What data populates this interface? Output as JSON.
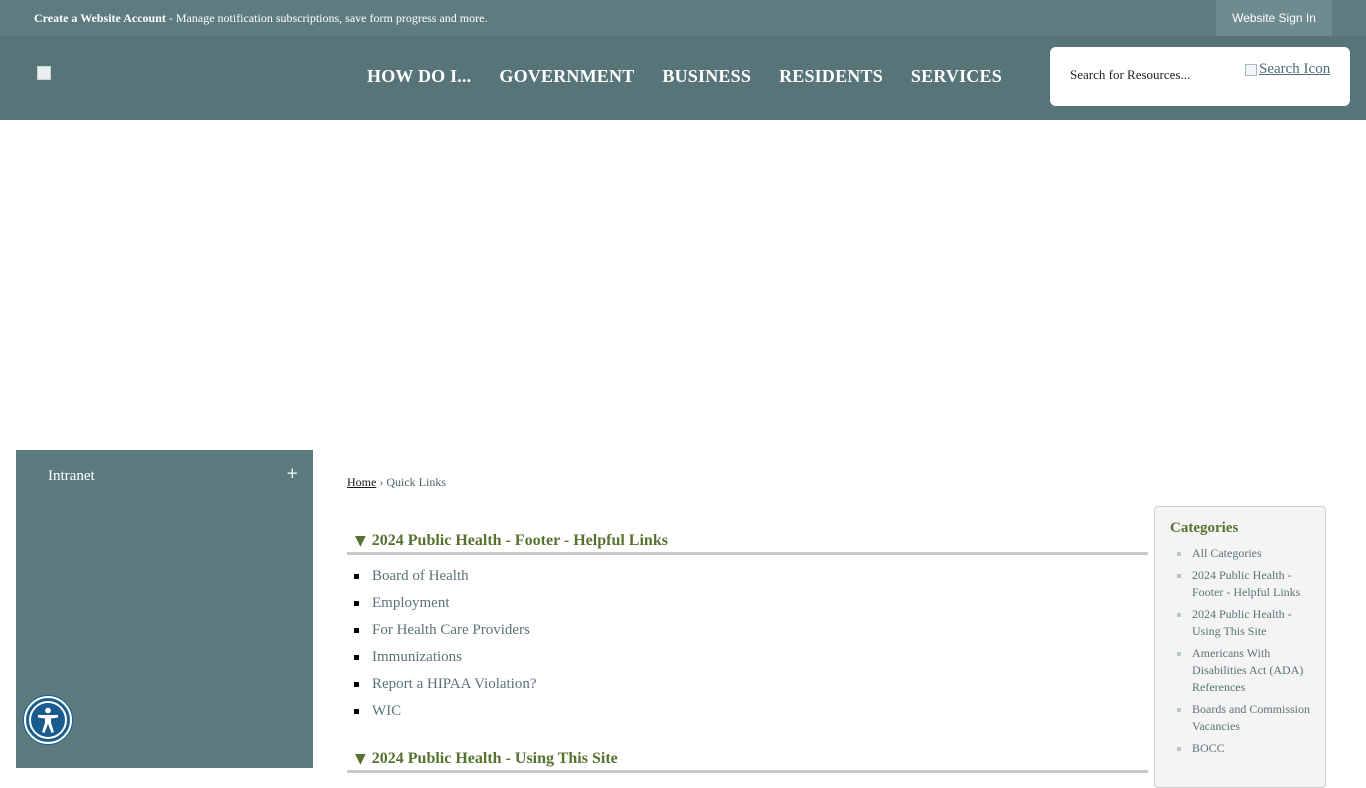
{
  "topbar": {
    "account_bold": "Create a Website Account",
    "account_rest": " - Manage notification subscriptions, save form progress and more.",
    "signin": "Website Sign In"
  },
  "nav": {
    "items": [
      "HOW DO I...",
      "GOVERNMENT",
      "BUSINESS",
      "RESIDENTS",
      "SERVICES"
    ]
  },
  "search": {
    "placeholder": "Search for Resources...",
    "icon_alt": "Search Icon"
  },
  "sidebar": {
    "item": "Intranet",
    "expand": "+"
  },
  "breadcrumb": {
    "home": "Home",
    "sep": "›",
    "current": "Quick Links"
  },
  "sections": [
    {
      "title": "2024 Public Health - Footer - Helpful Links",
      "links": [
        "Board of Health",
        "Employment",
        "For Health Care Providers",
        "Immunizations",
        "Report a HIPAA Violation?",
        "WIC"
      ]
    },
    {
      "title": "2024 Public Health - Using This Site",
      "links": []
    }
  ],
  "categories": {
    "title": "Categories",
    "items": [
      "All Categories",
      "2024 Public Health - Footer - Helpful Links",
      "2024 Public Health - Using This Site",
      "Americans With Disabilities Act (ADA) References",
      "Boards and Commission Vacancies",
      "BOCC"
    ]
  },
  "colors": {
    "topbar": "#5e7c80",
    "header": "#577579",
    "sidebar": "#5b7a7e",
    "accent_green": "#56722f",
    "link": "#5b7376",
    "accessibility": "#1a5c8c"
  },
  "icons": {
    "logo": "broken-image-icon",
    "search": "broken-image-icon",
    "accessibility": "accessibility-icon",
    "collapse": "triangle-down-icon"
  }
}
